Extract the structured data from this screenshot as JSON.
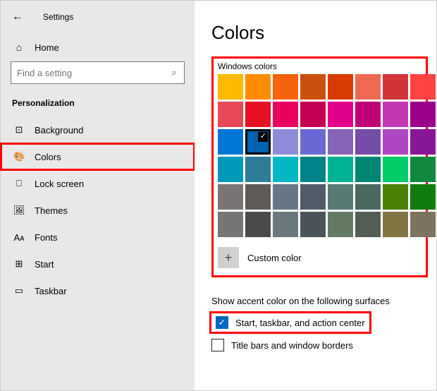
{
  "top": {
    "title": "Settings"
  },
  "home_label": "Home",
  "search": {
    "placeholder": "Find a setting"
  },
  "group": "Personalization",
  "nav": [
    {
      "icon": "⊡",
      "label": "Background",
      "selected": false
    },
    {
      "icon": "🎨",
      "label": "Colors",
      "selected": true
    },
    {
      "icon": "⎕",
      "label": "Lock screen",
      "selected": false
    },
    {
      "icon": "🖼",
      "label": "Themes",
      "selected": false
    },
    {
      "icon": "Aᴀ",
      "label": "Fonts",
      "selected": false
    },
    {
      "icon": "⊞",
      "label": "Start",
      "selected": false
    },
    {
      "icon": "▭",
      "label": "Taskbar",
      "selected": false
    }
  ],
  "page_title": "Colors",
  "panel_label": "Windows colors",
  "colors": [
    [
      "#FFB900",
      "#FF8C00",
      "#F7630C",
      "#CA5010",
      "#DA3B01",
      "#EF6950",
      "#D13438",
      "#FF4343"
    ],
    [
      "#E74856",
      "#E81123",
      "#EA005E",
      "#C30052",
      "#E3008C",
      "#BF0077",
      "#C239B3",
      "#9A0089"
    ],
    [
      "#0078D7",
      "#0063B1",
      "#8E8CD8",
      "#6B69D6",
      "#8764B8",
      "#744DA9",
      "#B146C2",
      "#881798"
    ],
    [
      "#0099BC",
      "#2D7D9A",
      "#00B7C3",
      "#038387",
      "#00B294",
      "#018574",
      "#00CC6A",
      "#10893E"
    ],
    [
      "#7A7574",
      "#5D5A58",
      "#68768A",
      "#515C6B",
      "#567C73",
      "#486860",
      "#498205",
      "#107C10"
    ],
    [
      "#767676",
      "#4C4A48",
      "#69797E",
      "#4A5459",
      "#647C64",
      "#525E54",
      "#847545",
      "#7E735F"
    ]
  ],
  "selected_swatch": {
    "row": 2,
    "col": 1
  },
  "custom_label": "Custom color",
  "section_sub": "Show accent color on the following surfaces",
  "chk1": {
    "label": "Start, taskbar, and action center",
    "checked": true
  },
  "chk2": {
    "label": "Title bars and window borders",
    "checked": false
  }
}
